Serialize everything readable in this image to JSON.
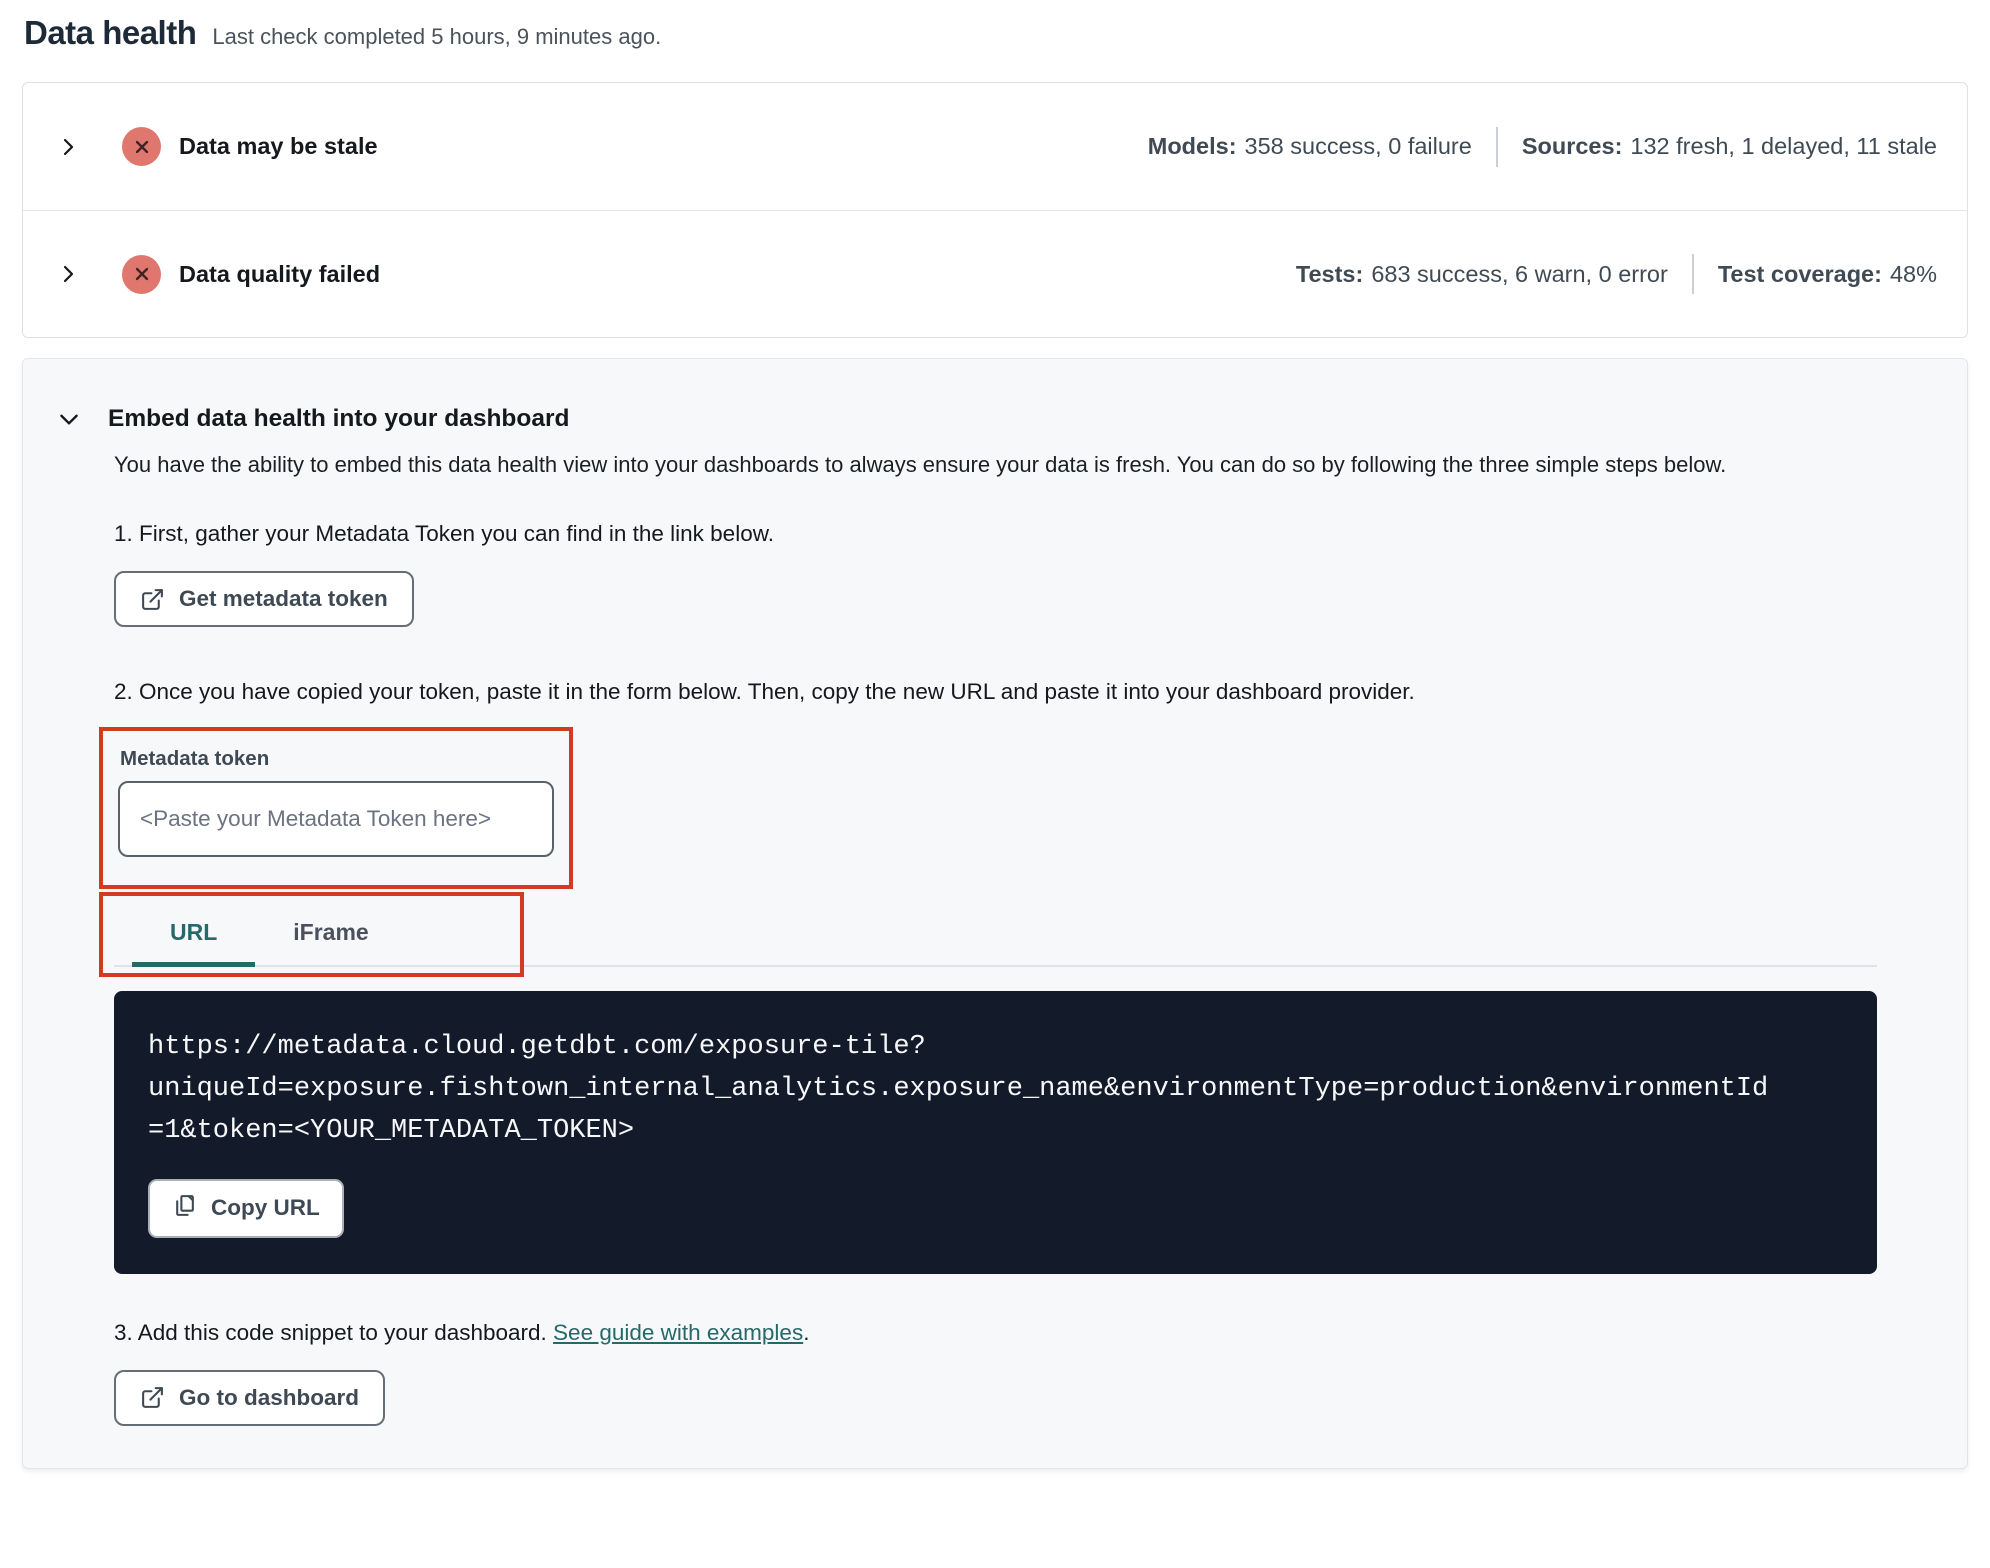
{
  "page": {
    "title": "Data health",
    "subtitle": "Last check completed 5 hours, 9 minutes ago."
  },
  "status_panel": {
    "rows": [
      {
        "label": "Data may be stale",
        "status_icon": "x-circle-icon",
        "stats": [
          {
            "label": "Models:",
            "value": "358 success, 0 failure"
          },
          {
            "label": "Sources:",
            "value": "132 fresh, 1 delayed, 11 stale"
          }
        ]
      },
      {
        "label": "Data quality failed",
        "status_icon": "x-circle-icon",
        "stats": [
          {
            "label": "Tests:",
            "value": "683 success, 6 warn, 0 error"
          },
          {
            "label": "Test coverage:",
            "value": "48%"
          }
        ]
      }
    ]
  },
  "embed_panel": {
    "title": "Embed data health into your dashboard",
    "description": "You have the ability to embed this data health view into your dashboards to always ensure your data is fresh. You can do so by following the three simple steps below.",
    "step1": {
      "text": "1. First, gather your Metadata Token you can find in the link below.",
      "button_label": "Get metadata token",
      "button_icon": "external-link-icon"
    },
    "step2": {
      "text": "2. Once you have copied your token, paste it in the form below. Then, copy the new URL and paste it into your dashboard provider.",
      "token_field": {
        "label": "Metadata token",
        "value": "",
        "placeholder": "<Paste your Metadata Token here>"
      },
      "tabs": [
        {
          "label": "URL",
          "active": true
        },
        {
          "label": "iFrame",
          "active": false
        }
      ],
      "code": "https://metadata.cloud.getdbt.com/exposure-tile?\nuniqueId=exposure.fishtown_internal_analytics.exposure_name&environmentType=production&environmentId\n=1&token=<YOUR_METADATA_TOKEN>",
      "copy_button_label": "Copy URL",
      "copy_button_icon": "copy-icon"
    },
    "step3": {
      "text_before_link": "3. Add this code snippet to your dashboard. ",
      "link_text": "See guide with examples",
      "text_after_link": ".",
      "button_label": "Go to dashboard",
      "button_icon": "external-link-icon"
    }
  },
  "colors": {
    "error_badge_bg": "#e0776f",
    "annotation_red": "#d03b21",
    "teal_accent": "#26696b",
    "code_block_bg": "#131a2a",
    "panel_bg": "#f7f8fa"
  }
}
